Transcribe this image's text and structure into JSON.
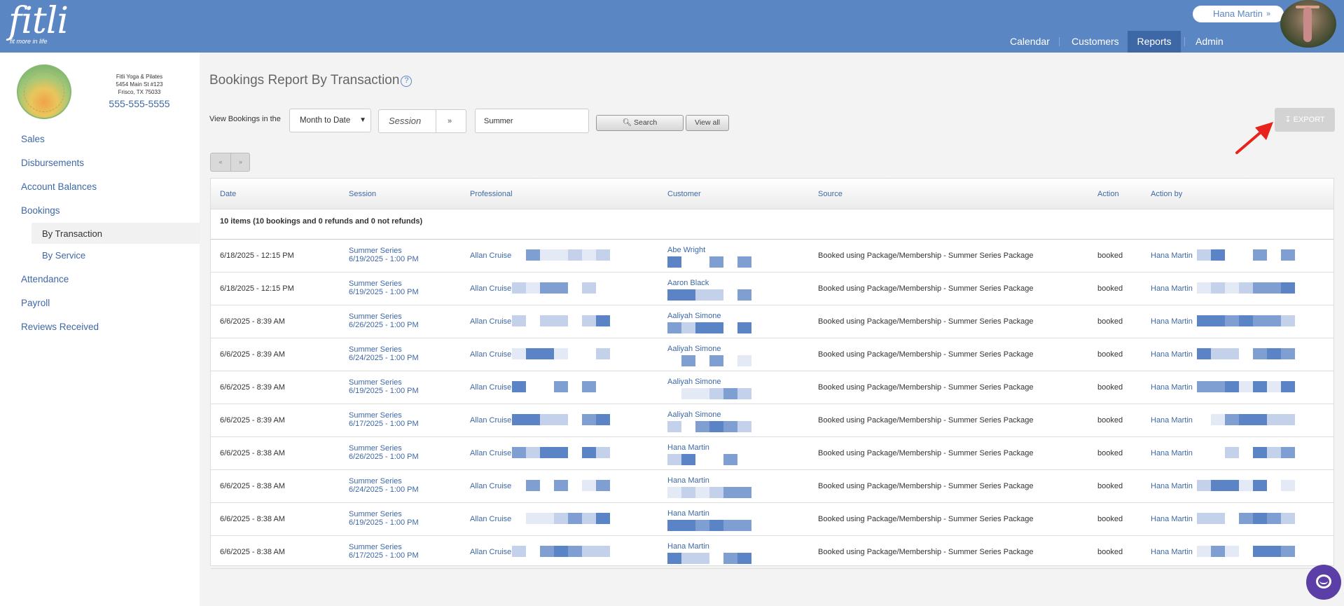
{
  "header": {
    "logo_text": "fitli",
    "tagline": "fit more in life",
    "user_name": "Hana Martin",
    "nav": [
      {
        "label": "Calendar",
        "active": false
      },
      {
        "label": "Customers",
        "active": false
      },
      {
        "label": "Reports",
        "active": true
      },
      {
        "label": "Admin",
        "active": false
      }
    ]
  },
  "studio": {
    "name": "Fitli Yoga & Pilates",
    "address1": "5454 Main St #123",
    "address2": "Frisco, TX 75033",
    "phone": "555-555-5555"
  },
  "sidebar": {
    "items": [
      {
        "label": "Sales"
      },
      {
        "label": "Disbursements"
      },
      {
        "label": "Account Balances"
      },
      {
        "label": "Bookings"
      },
      {
        "label": "By Transaction"
      },
      {
        "label": "By Service"
      },
      {
        "label": "Attendance"
      },
      {
        "label": "Payroll"
      },
      {
        "label": "Reviews Received"
      }
    ]
  },
  "report": {
    "title": "Bookings Report By Transaction",
    "help_icon": "question-circle-icon",
    "filter_label": "View Bookings in the",
    "period_value": "Month to Date",
    "session_placeholder": "Session",
    "search_value": "Summer",
    "search_label": "Search",
    "view_all_label": "View all",
    "export_label": "EXPORT",
    "pager_prev": "«",
    "pager_next": "»"
  },
  "table": {
    "headers": [
      "Date",
      "Session",
      "Professional",
      "Customer",
      "Source",
      "Action",
      "Action by"
    ],
    "summary": "10 items (10 bookings and 0 refunds and 0 not refunds)",
    "rows": [
      {
        "date": "6/18/2025 - 12:15 PM",
        "session": "Summer Series",
        "session_time": "6/19/2025 - 1:00 PM",
        "professional": "Allan Cruise",
        "customer": "Abe Wright",
        "source": "Booked using Package/Membership - Summer Series Package",
        "action": "booked",
        "action_by": "Hana Martin"
      },
      {
        "date": "6/18/2025 - 12:15 PM",
        "session": "Summer Series",
        "session_time": "6/19/2025 - 1:00 PM",
        "professional": "Allan Cruise",
        "customer": "Aaron Black",
        "source": "Booked using Package/Membership - Summer Series Package",
        "action": "booked",
        "action_by": "Hana Martin"
      },
      {
        "date": "6/6/2025 - 8:39 AM",
        "session": "Summer Series",
        "session_time": "6/26/2025 - 1:00 PM",
        "professional": "Allan Cruise",
        "customer": "Aaliyah Simone",
        "source": "Booked using Package/Membership - Summer Series Package",
        "action": "booked",
        "action_by": "Hana Martin"
      },
      {
        "date": "6/6/2025 - 8:39 AM",
        "session": "Summer Series",
        "session_time": "6/24/2025 - 1:00 PM",
        "professional": "Allan Cruise",
        "customer": "Aaliyah Simone",
        "source": "Booked using Package/Membership - Summer Series Package",
        "action": "booked",
        "action_by": "Hana Martin"
      },
      {
        "date": "6/6/2025 - 8:39 AM",
        "session": "Summer Series",
        "session_time": "6/19/2025 - 1:00 PM",
        "professional": "Allan Cruise",
        "customer": "Aaliyah Simone",
        "source": "Booked using Package/Membership - Summer Series Package",
        "action": "booked",
        "action_by": "Hana Martin"
      },
      {
        "date": "6/6/2025 - 8:39 AM",
        "session": "Summer Series",
        "session_time": "6/17/2025 - 1:00 PM",
        "professional": "Allan Cruise",
        "customer": "Aaliyah Simone",
        "source": "Booked using Package/Membership - Summer Series Package",
        "action": "booked",
        "action_by": "Hana Martin"
      },
      {
        "date": "6/6/2025 - 8:38 AM",
        "session": "Summer Series",
        "session_time": "6/26/2025 - 1:00 PM",
        "professional": "Allan Cruise",
        "customer": "Hana Martin",
        "source": "Booked using Package/Membership - Summer Series Package",
        "action": "booked",
        "action_by": "Hana Martin"
      },
      {
        "date": "6/6/2025 - 8:38 AM",
        "session": "Summer Series",
        "session_time": "6/24/2025 - 1:00 PM",
        "professional": "Allan Cruise",
        "customer": "Hana Martin",
        "source": "Booked using Package/Membership - Summer Series Package",
        "action": "booked",
        "action_by": "Hana Martin"
      },
      {
        "date": "6/6/2025 - 8:38 AM",
        "session": "Summer Series",
        "session_time": "6/19/2025 - 1:00 PM",
        "professional": "Allan Cruise",
        "customer": "Hana Martin",
        "source": "Booked using Package/Membership - Summer Series Package",
        "action": "booked",
        "action_by": "Hana Martin"
      },
      {
        "date": "6/6/2025 - 8:38 AM",
        "session": "Summer Series",
        "session_time": "6/17/2025 - 1:00 PM",
        "professional": "Allan Cruise",
        "customer": "Hana Martin",
        "source": "Booked using Package/Membership - Summer Series Package",
        "action": "booked",
        "action_by": "Hana Martin"
      }
    ]
  },
  "colors": {
    "header_bg": "#5b86c4",
    "nav_active": "#3e68a5",
    "link": "#3e68a5",
    "export_disabled": "#d3d3d3",
    "chat": "#5b3fa6",
    "annotation_arrow": "#e8231d"
  }
}
